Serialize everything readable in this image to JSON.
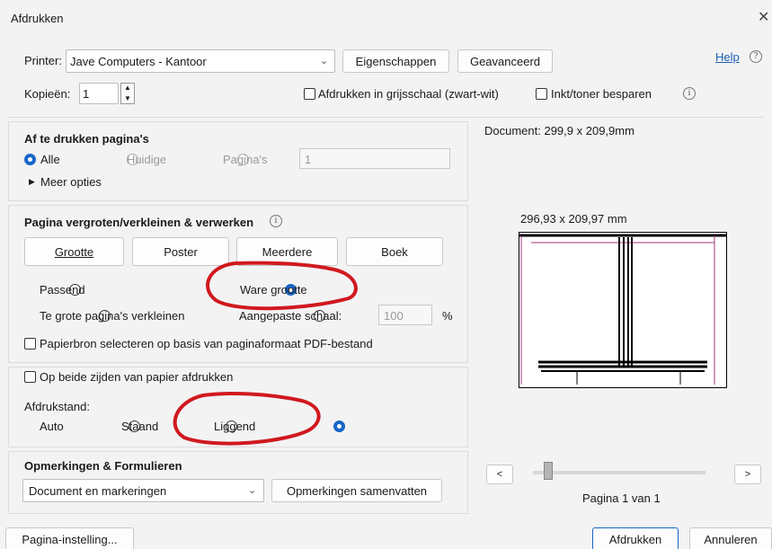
{
  "window": {
    "title": "Afdrukken"
  },
  "printer": {
    "label": "Printer:",
    "value": "Jave Computers - Kantoor",
    "properties_button": "Eigenschappen",
    "advanced_button": "Geavanceerd",
    "help_link": "Help"
  },
  "copies": {
    "label": "Kopieën:",
    "value": "1",
    "grayscale_label": "Afdrukken in grijsschaal (zwart-wit)",
    "save_ink_label": "Inkt/toner besparen"
  },
  "pages_section": {
    "title": "Af te drukken pagina's",
    "options": [
      "Alle",
      "Huidige",
      "Pagina's"
    ],
    "range_value": "1",
    "more_options": "Meer opties"
  },
  "scaling_section": {
    "title": "Pagina vergroten/verkleinen & verwerken",
    "tabs": [
      "Grootte",
      "Poster",
      "Meerdere",
      "Boek"
    ],
    "fit_label": "Passend",
    "actual_size_label": "Ware grootte",
    "shrink_label": "Te grote pagina's verkleinen",
    "custom_scale_label": "Aangepaste schaal:",
    "custom_scale_value": "100",
    "percent": "%",
    "paper_source_label": "Papierbron selecteren op basis van paginaformaat PDF-bestand"
  },
  "duplex_label": "Op beide zijden van papier afdrukken",
  "orientation": {
    "label": "Afdrukstand:",
    "options": [
      "Auto",
      "Staand",
      "Liggend"
    ]
  },
  "comments": {
    "title": "Opmerkingen & Formulieren",
    "value": "Document en markeringen",
    "summarize_button": "Opmerkingen samenvatten"
  },
  "preview": {
    "document_size": "Document: 299,9 x 209,9mm",
    "page_size": "296,93 x 209,97 mm",
    "prev": "<",
    "next": ">",
    "page_indicator": "Pagina 1 van 1"
  },
  "footer": {
    "page_setup_button": "Pagina-instelling...",
    "print_button": "Afdrukken",
    "cancel_button": "Annuleren"
  },
  "colors": {
    "accent": "#1766c8",
    "annotation": "#d0191f"
  }
}
